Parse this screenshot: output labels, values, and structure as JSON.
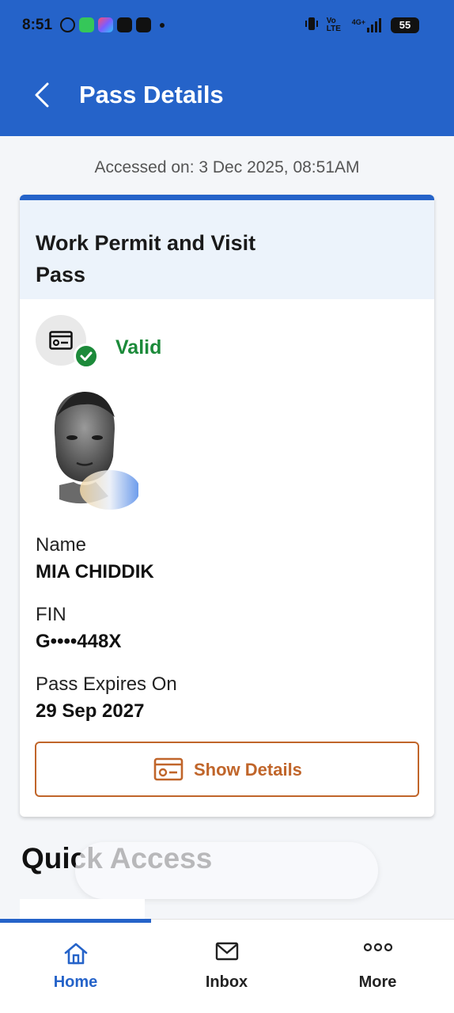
{
  "status_bar": {
    "time": "8:51",
    "network_label": "Vo LTE",
    "signal_label": "4G+",
    "battery": "55"
  },
  "header": {
    "title": "Pass Details",
    "back_icon": "chevron-left-icon"
  },
  "accessed_text": "Accessed on: 3 Dec 2025, 08:51AM",
  "pass_card": {
    "title": "Work Permit and Visit Pass",
    "status": "Valid",
    "status_color": "#1c8a3a",
    "fields": [
      {
        "label": "Name",
        "value": "MIA CHIDDIK"
      },
      {
        "label": "FIN",
        "value": "G••••448X"
      },
      {
        "label": "Pass Expires On",
        "value": "29 Sep 2027"
      }
    ],
    "show_details_label": "Show Details"
  },
  "quick_access": {
    "title": "Quick Access"
  },
  "bottom_nav": {
    "items": [
      {
        "label": "Home",
        "icon": "home-icon",
        "active": true
      },
      {
        "label": "Inbox",
        "icon": "mail-icon",
        "active": false
      },
      {
        "label": "More",
        "icon": "more-dots-icon",
        "active": false
      }
    ]
  },
  "colors": {
    "primary": "#2563c9",
    "accent_orange": "#c0652a",
    "success": "#1c8a3a"
  }
}
